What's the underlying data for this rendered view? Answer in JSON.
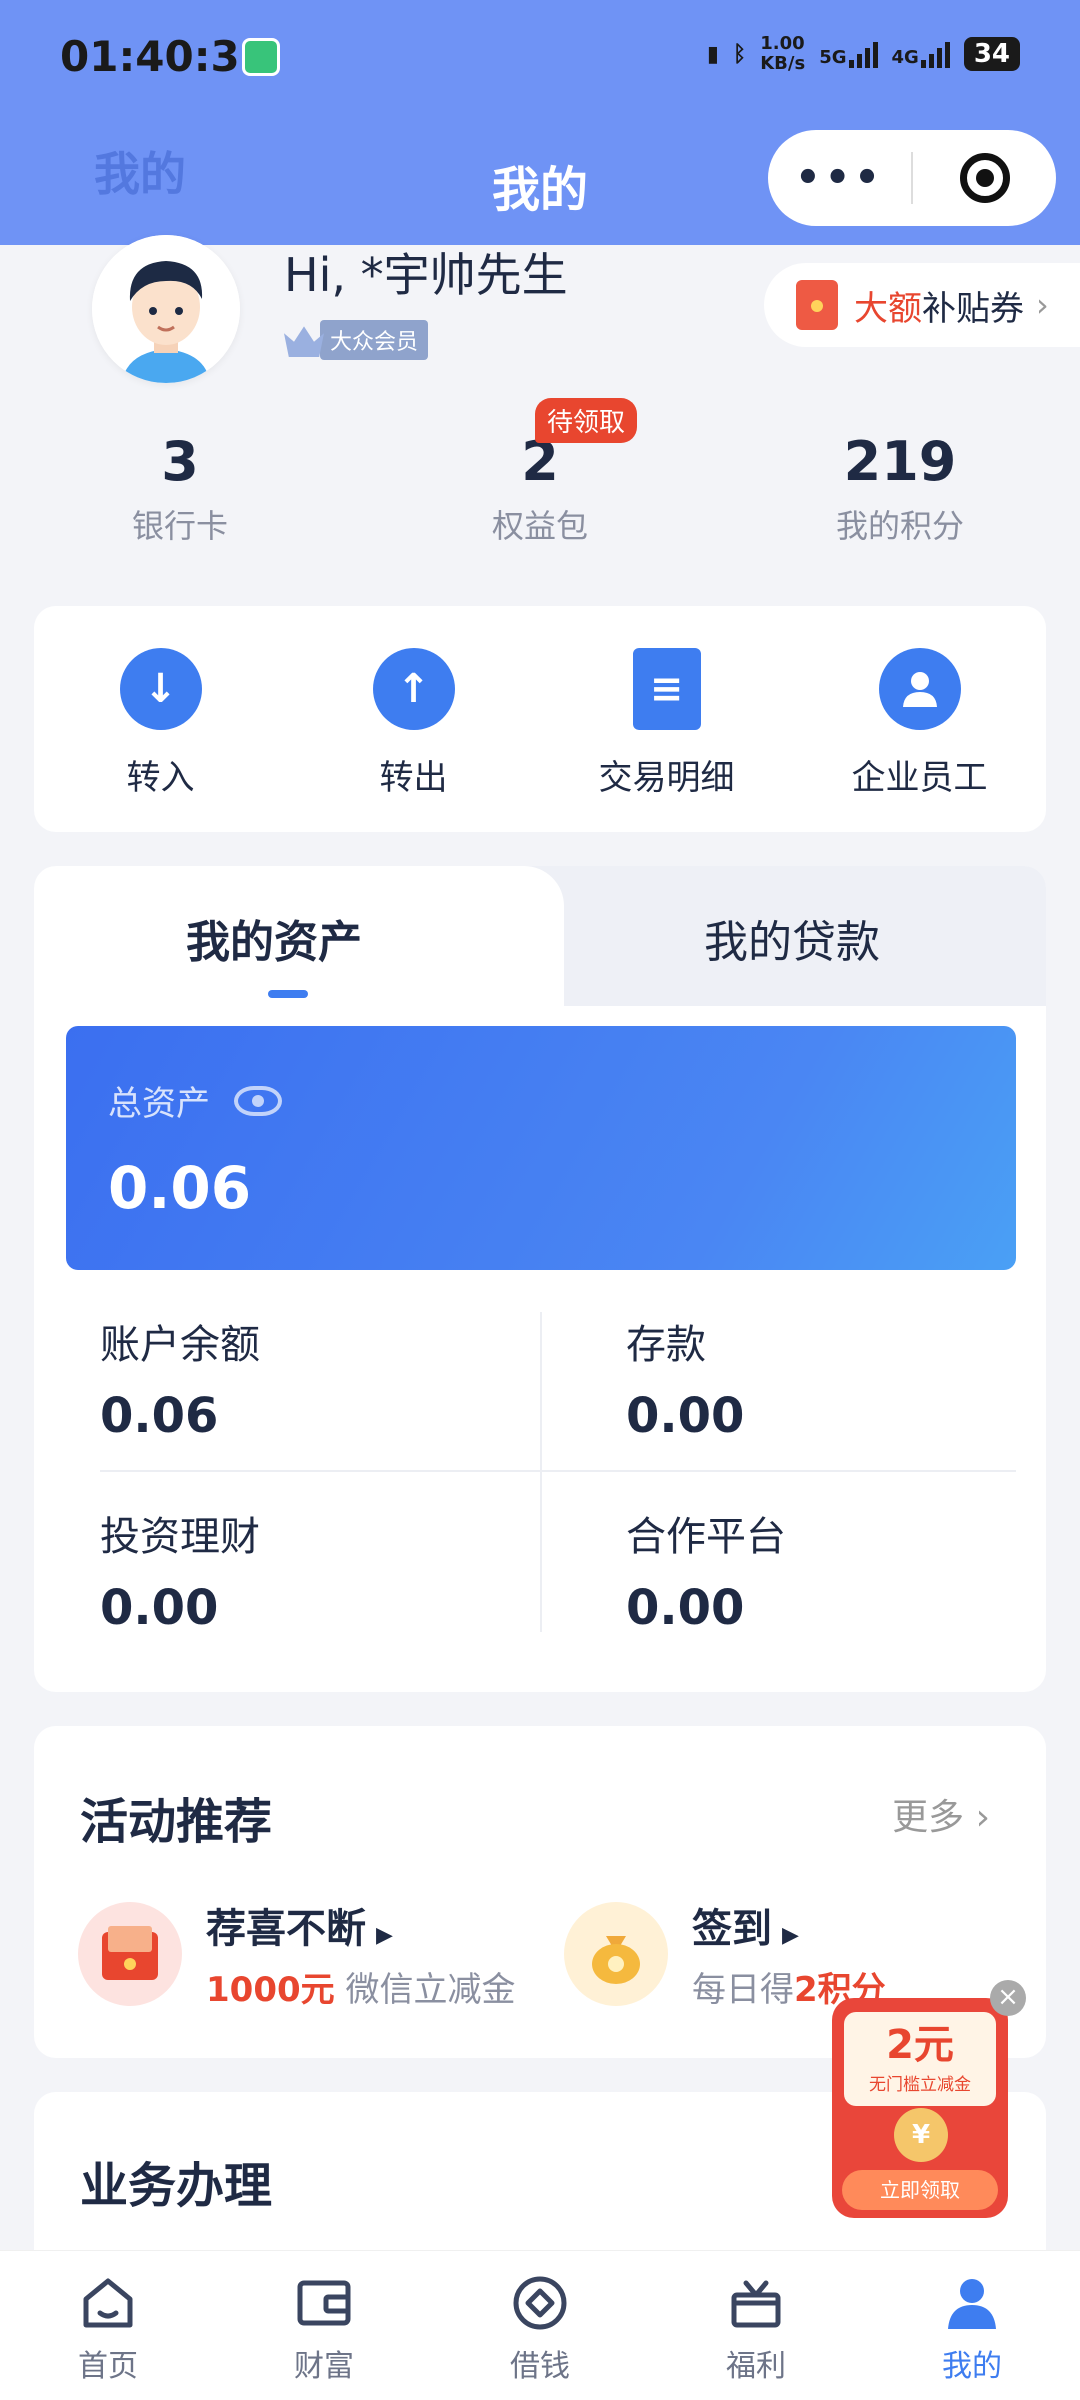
{
  "status_bar": {
    "time": "01:40:36",
    "net_speed_top": "1.00",
    "net_speed_unit": "KB/s",
    "signal1": "5G",
    "signal2": "4G",
    "battery": "34"
  },
  "nav": {
    "left_title": "我的",
    "title": "我的",
    "more_label": "•••"
  },
  "profile": {
    "greeting": "Hi, *宇帅先生",
    "member_level": "大众会员",
    "coupon_highlight": "大额",
    "coupon_rest": "补贴券"
  },
  "stats": [
    {
      "value": "3",
      "label": "银行卡"
    },
    {
      "value": "2",
      "label": "权益包"
    },
    {
      "value": "219",
      "label": "我的积分"
    }
  ],
  "pending_badge": "待领取",
  "quick_actions": [
    {
      "label": "转入",
      "icon": "arrow-down-icon"
    },
    {
      "label": "转出",
      "icon": "arrow-up-icon"
    },
    {
      "label": "交易明细",
      "icon": "document-icon"
    },
    {
      "label": "企业员工",
      "icon": "person-icon"
    }
  ],
  "assets": {
    "tab_active": "我的资产",
    "tab_inactive": "我的贷款",
    "total_label": "总资产",
    "total_value": "0.06",
    "cells": [
      {
        "label": "账户余额",
        "value": "0.06"
      },
      {
        "label": "存款",
        "value": "0.00"
      },
      {
        "label": "投资理财",
        "value": "0.00"
      },
      {
        "label": "合作平台",
        "value": "0.00"
      }
    ]
  },
  "activity": {
    "title": "活动推荐",
    "more": "更多",
    "items": [
      {
        "name": "荐喜不断",
        "sub_highlight": "1000元",
        "sub_rest": " 微信立减金"
      },
      {
        "name": "签到",
        "sub_rest": "每日得",
        "sub_highlight": "2积分"
      }
    ]
  },
  "business": {
    "title": "业务办理"
  },
  "floating_coupon": {
    "amount": "2元",
    "subtitle": "无门槛立减金",
    "coin": "¥",
    "button": "立即领取"
  },
  "bottom_nav": [
    {
      "label": "首页",
      "icon": "home-icon"
    },
    {
      "label": "财富",
      "icon": "wallet-icon"
    },
    {
      "label": "借钱",
      "icon": "loan-icon"
    },
    {
      "label": "福利",
      "icon": "gift-icon"
    },
    {
      "label": "我的",
      "icon": "me-icon"
    }
  ],
  "colors": {
    "header": "#6f93f5",
    "accent": "#3e7df0",
    "red": "#e8462f"
  }
}
